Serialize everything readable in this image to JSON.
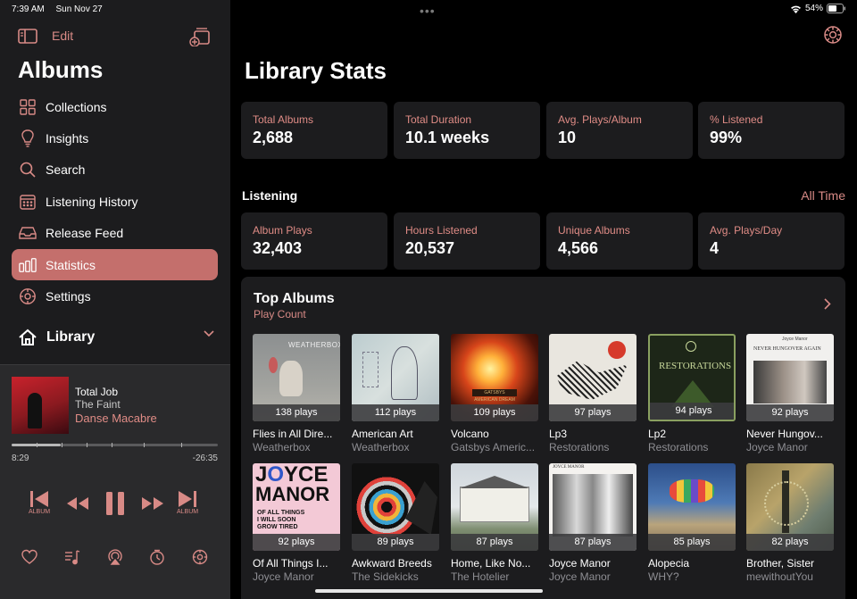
{
  "status": {
    "time": "7:39 AM",
    "date": "Sun Nov 27",
    "battery": "54%"
  },
  "sidebar": {
    "edit_label": "Edit",
    "title": "Albums",
    "items": [
      {
        "label": "Collections",
        "icon": "grid-icon"
      },
      {
        "label": "Insights",
        "icon": "lightbulb-icon"
      },
      {
        "label": "Search",
        "icon": "search-icon"
      },
      {
        "label": "Listening History",
        "icon": "calendar-icon"
      },
      {
        "label": "Release Feed",
        "icon": "tray-icon"
      },
      {
        "label": "Statistics",
        "icon": "bar-chart-icon",
        "active": true
      },
      {
        "label": "Settings",
        "icon": "gear-icon"
      }
    ],
    "library_label": "Library"
  },
  "now_playing": {
    "song": "Total Job",
    "artist": "The Faint",
    "album": "Danse Macabre",
    "elapsed": "8:29",
    "remaining": "-26:35",
    "progress": 0.24,
    "prev_album_caption": "ALBUM",
    "next_album_caption": "ALBUM"
  },
  "main": {
    "title": "Library Stats",
    "summary": [
      {
        "label": "Total Albums",
        "value": "2,688"
      },
      {
        "label": "Total Duration",
        "value": "10.1 weeks"
      },
      {
        "label": "Avg. Plays/Album",
        "value": "10"
      },
      {
        "label": "% Listened",
        "value": "99%"
      }
    ],
    "listening_label": "Listening",
    "range_label": "All Time",
    "listening": [
      {
        "label": "Album Plays",
        "value": "32,403"
      },
      {
        "label": "Hours Listened",
        "value": "20,537"
      },
      {
        "label": "Unique Albums",
        "value": "4,566"
      },
      {
        "label": "Avg. Plays/Day",
        "value": "4"
      }
    ],
    "top_albums": {
      "title": "Top Albums",
      "subtitle": "Play Count",
      "albums": [
        {
          "name": "Flies in All Dire...",
          "artist": "Weatherbox",
          "plays": "138 plays"
        },
        {
          "name": "American Art",
          "artist": "Weatherbox",
          "plays": "112 plays"
        },
        {
          "name": "Volcano",
          "artist": "Gatsbys Americ...",
          "plays": "109 plays"
        },
        {
          "name": "Lp3",
          "artist": "Restorations",
          "plays": "97 plays"
        },
        {
          "name": "Lp2",
          "artist": "Restorations",
          "plays": "94 plays"
        },
        {
          "name": "Never Hungov...",
          "artist": "Joyce Manor",
          "plays": "92 plays"
        },
        {
          "name": "Of All Things I...",
          "artist": "Joyce Manor",
          "plays": "92 plays"
        },
        {
          "name": "Awkward Breeds",
          "artist": "The Sidekicks",
          "plays": "89 plays"
        },
        {
          "name": "Home, Like No...",
          "artist": "The Hotelier",
          "plays": "87 plays"
        },
        {
          "name": "Joyce Manor",
          "artist": "Joyce Manor",
          "plays": "87 plays"
        },
        {
          "name": "Alopecia",
          "artist": "WHY?",
          "plays": "85 plays"
        },
        {
          "name": "Brother, Sister",
          "artist": "mewithoutYou",
          "plays": "82 plays"
        }
      ]
    }
  },
  "colors": {
    "accent": "#d88a86",
    "active_bg": "#c46f6c",
    "card_bg": "#1c1c1e"
  }
}
